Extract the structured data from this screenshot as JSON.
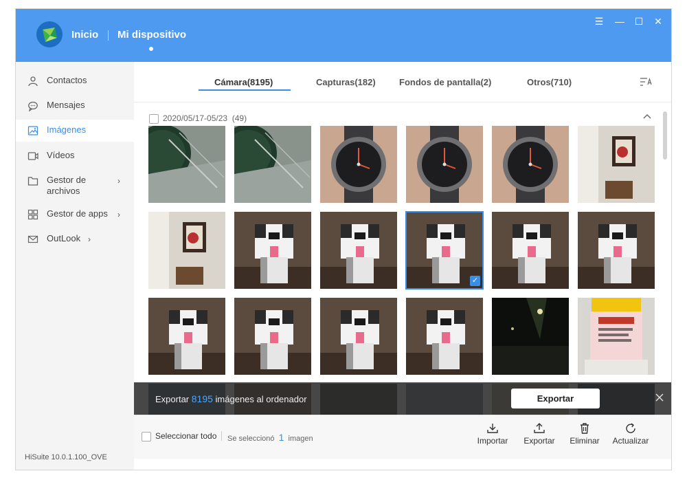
{
  "header": {
    "nav_home": "Inicio",
    "nav_device": "Mi dispositivo",
    "brand_color": "#4e9af1"
  },
  "window_controls": {
    "menu": "☰",
    "minimize": "—",
    "maximize": "☐",
    "close": "✕"
  },
  "sidebar": {
    "items": [
      {
        "label": "Contactos",
        "icon": "person-icon"
      },
      {
        "label": "Mensajes",
        "icon": "chat-icon"
      },
      {
        "label": "Imágenes",
        "icon": "image-icon",
        "active": true
      },
      {
        "label": "Vídeos",
        "icon": "video-icon"
      },
      {
        "label": "Gestor de archivos",
        "icon": "folder-icon"
      },
      {
        "label": "Gestor de apps",
        "icon": "apps-icon"
      },
      {
        "label": "OutLook",
        "icon": "mail-icon"
      }
    ],
    "version": "HiSuite 10.0.1.100_OVE"
  },
  "tabs": [
    {
      "label": "Cámara(8195)",
      "active": true
    },
    {
      "label": "Capturas(182)"
    },
    {
      "label": "Fondos de pantalla(2)"
    },
    {
      "label": "Otros(710)"
    }
  ],
  "group": {
    "label": "2020/05/17-05/23",
    "count": "(49)"
  },
  "photos": [
    {
      "subject": "plastic-box"
    },
    {
      "subject": "plastic-box"
    },
    {
      "subject": "watch"
    },
    {
      "subject": "watch"
    },
    {
      "subject": "watch"
    },
    {
      "subject": "shelf"
    },
    {
      "subject": "shelf"
    },
    {
      "subject": "dog-figure"
    },
    {
      "subject": "dog-figure"
    },
    {
      "subject": "dog-figure",
      "selected": true
    },
    {
      "subject": "dog-figure"
    },
    {
      "subject": "dog-figure"
    },
    {
      "subject": "dog-figure"
    },
    {
      "subject": "dog-figure"
    },
    {
      "subject": "dog-figure"
    },
    {
      "subject": "dog-figure"
    },
    {
      "subject": "night-street"
    },
    {
      "subject": "price-sign"
    }
  ],
  "export_bar": {
    "prefix": "Exportar",
    "count": "8195",
    "suffix": "imágenes al ordenador",
    "button": "Exportar"
  },
  "bottom_bar": {
    "select_all": "Seleccionar todo",
    "selected_prefix": "Se seleccionó",
    "selected_count": "1",
    "selected_suffix": "imagen",
    "actions": [
      {
        "label": "Importar",
        "icon": "import-icon"
      },
      {
        "label": "Exportar",
        "icon": "export-icon"
      },
      {
        "label": "Eliminar",
        "icon": "trash-icon"
      },
      {
        "label": "Actualizar",
        "icon": "refresh-icon"
      }
    ]
  }
}
